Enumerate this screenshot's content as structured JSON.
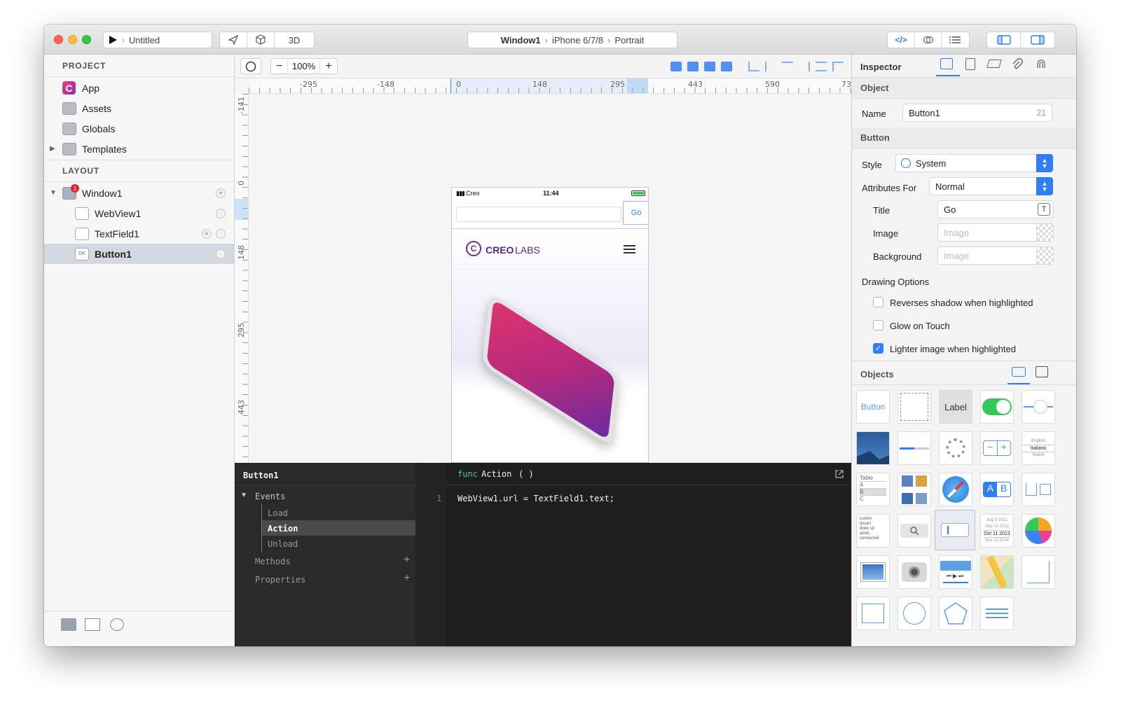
{
  "titlebar": {
    "run_target": "Untitled",
    "view_3d_label": "3D",
    "breadcrumb": [
      "Window1",
      "iPhone 6/7/8",
      "Portrait"
    ]
  },
  "sidebar": {
    "project_header": "PROJECT",
    "project_items": [
      {
        "label": "App",
        "icon": "app-icon"
      },
      {
        "label": "Assets",
        "icon": "assets-folder-icon"
      },
      {
        "label": "Globals",
        "icon": "globals-folder-icon"
      },
      {
        "label": "Templates",
        "icon": "templates-folder-icon"
      }
    ],
    "layout_header": "LAYOUT",
    "layout_items": [
      {
        "label": "Window1",
        "badge": "1",
        "selected": false
      },
      {
        "label": "WebView1",
        "selected": false
      },
      {
        "label": "TextField1",
        "selected": false
      },
      {
        "label": "Button1",
        "selected": true
      }
    ]
  },
  "canvas": {
    "zoom": "100%",
    "ruler_h": [
      "-295",
      "-148",
      "0",
      "148",
      "295",
      "443",
      "590",
      "73"
    ],
    "ruler_v": [
      "-141",
      "0",
      "148",
      "295",
      "443"
    ]
  },
  "phone": {
    "carrier": "Creo",
    "time": "11:44",
    "go_label": "Go",
    "brand_bold": "CREO",
    "brand_light": "LABS"
  },
  "code_editor": {
    "object_name": "Button1",
    "events_label": "Events",
    "events": [
      "Load",
      "Action",
      "Unload"
    ],
    "selected_event": "Action",
    "methods_label": "Methods",
    "properties_label": "Properties",
    "func_keyword": "func",
    "func_name": "Action",
    "func_parens": "(  )",
    "line_number": "1",
    "code_line": "WebView1.url = TextField1.text;"
  },
  "inspector": {
    "title": "Inspector",
    "object_section": "Object",
    "name_label": "Name",
    "name_value": "Button1",
    "name_count": "21",
    "button_section": "Button",
    "style_label": "Style",
    "style_value": "System",
    "attributes_label": "Attributes For",
    "attributes_value": "Normal",
    "title_label": "Title",
    "title_value": "Go",
    "image_label": "Image",
    "image_placeholder": "Image",
    "background_label": "Background",
    "background_placeholder": "Image",
    "drawing_options_label": "Drawing Options",
    "options": [
      {
        "label": "Reverses shadow when highlighted",
        "checked": false
      },
      {
        "label": "Glow on Touch",
        "checked": false
      },
      {
        "label": "Lighter image when highlighted",
        "checked": true
      }
    ]
  },
  "objects": {
    "title": "Objects",
    "button_label": "Button",
    "label_label": "Label",
    "table_lines": [
      "Table",
      "A",
      "B",
      "C"
    ],
    "text_lines": [
      "Lorem",
      "ipsum",
      "dolor sit",
      "amet,",
      "consected"
    ],
    "picker_lines": [
      "English",
      "Italiano",
      "Suomi"
    ],
    "date_lines": [
      "Aug 9 2011",
      "Sep 10 2012",
      "Oct 11 2013",
      "Nov 12 2014"
    ],
    "seg_a": "A",
    "seg_b": "B"
  },
  "colors": {
    "accent": "#2f7ef6",
    "brand": "#6c2d8f",
    "selection": "#d4d8e0",
    "code_bg": "#1e1e1e",
    "func_keyword": "#48c9a9"
  }
}
